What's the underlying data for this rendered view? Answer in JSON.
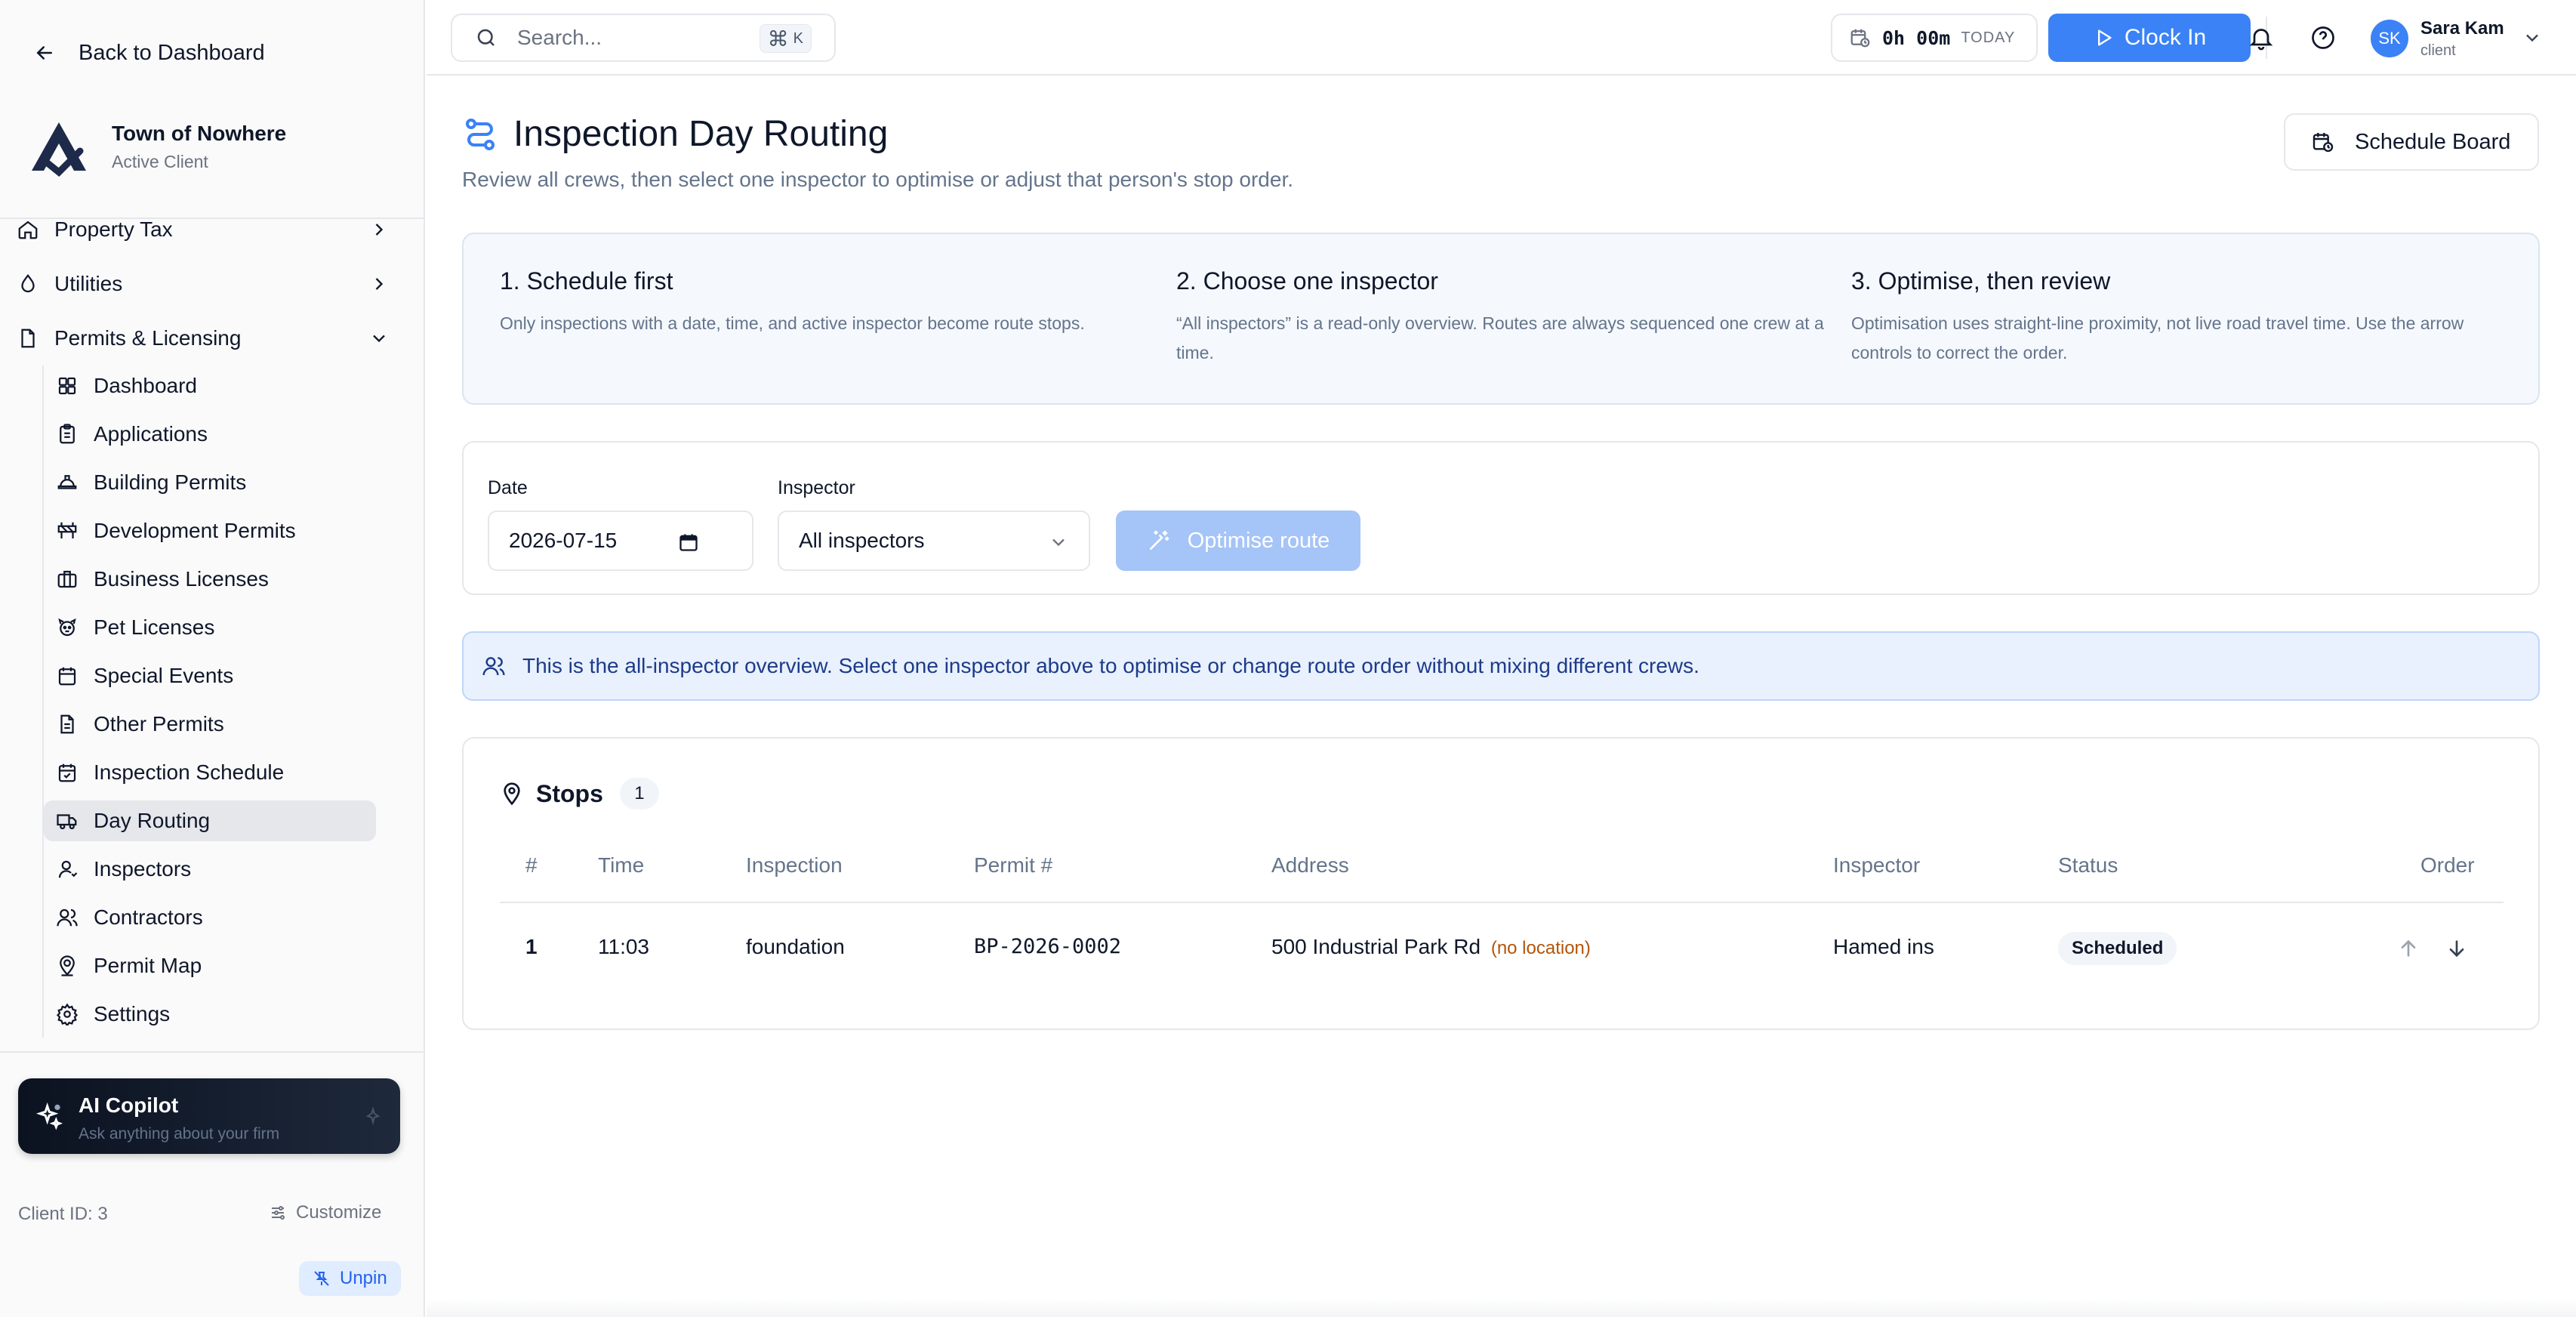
{
  "sidebar": {
    "back_label": "Back to Dashboard",
    "org_name": "Town of Nowhere",
    "org_status": "Active Client",
    "top_items": [
      {
        "label": "Property Tax",
        "icon": "home-icon"
      },
      {
        "label": "Utilities",
        "icon": "droplet-icon"
      },
      {
        "label": "Permits & Licensing",
        "icon": "file-icon"
      }
    ],
    "sub_items": [
      {
        "label": "Dashboard",
        "icon": "grid-icon"
      },
      {
        "label": "Applications",
        "icon": "clipboard-icon"
      },
      {
        "label": "Building Permits",
        "icon": "hard-hat-icon"
      },
      {
        "label": "Development Permits",
        "icon": "construction-icon"
      },
      {
        "label": "Business Licenses",
        "icon": "briefcase-icon"
      },
      {
        "label": "Pet Licenses",
        "icon": "paw-icon"
      },
      {
        "label": "Special Events",
        "icon": "calendar-icon"
      },
      {
        "label": "Other Permits",
        "icon": "document-icon"
      },
      {
        "label": "Inspection Schedule",
        "icon": "calendar-check-icon"
      },
      {
        "label": "Day Routing",
        "icon": "truck-icon"
      },
      {
        "label": "Inspectors",
        "icon": "user-icon"
      },
      {
        "label": "Contractors",
        "icon": "users-icon"
      },
      {
        "label": "Permit Map",
        "icon": "map-pin-user-icon"
      },
      {
        "label": "Settings",
        "icon": "gear-icon"
      }
    ],
    "active_item": "Day Routing",
    "copilot": {
      "title": "AI Copilot",
      "subtitle": "Ask anything about your firm"
    },
    "client_id": "Client ID: 3",
    "customize_label": "Customize",
    "unpin_label": "Unpin"
  },
  "topbar": {
    "search_placeholder": "Search...",
    "shortcut_symbol": "⌘",
    "shortcut_key": "K",
    "timer_value": "0h 00m",
    "timer_label": "TODAY",
    "clock_in_label": "Clock In",
    "user_initials": "SK",
    "user_name": "Sara Kam",
    "user_role": "client"
  },
  "page": {
    "title": "Inspection Day Routing",
    "subtitle": "Review all crews, then select one inspector to optimise or adjust that person's stop order.",
    "schedule_board_label": "Schedule Board"
  },
  "steps": [
    {
      "title": "1. Schedule first",
      "text": "Only inspections with a date, time, and active inspector become route stops."
    },
    {
      "title": "2. Choose one inspector",
      "text": "“All inspectors” is a read-only overview. Routes are always sequenced one crew at a time."
    },
    {
      "title": "3. Optimise, then review",
      "text": "Optimisation uses straight-line proximity, not live road travel time. Use the arrow controls to correct the order."
    }
  ],
  "filters": {
    "date_label": "Date",
    "date_value": "2026-07-15",
    "inspector_label": "Inspector",
    "inspector_value": "All inspectors",
    "optimise_label": "Optimise route"
  },
  "notice": "This is the all-inspector overview. Select one inspector above to optimise or change route order without mixing different crews.",
  "stops": {
    "title": "Stops",
    "count": "1",
    "columns": [
      "#",
      "Time",
      "Inspection",
      "Permit #",
      "Address",
      "Inspector",
      "Status",
      "Order"
    ],
    "rows": [
      {
        "num": "1",
        "time": "11:03",
        "inspection": "foundation",
        "permit": "BP-2026-0002",
        "address": "500 Industrial Park Rd",
        "address_note": "(no location)",
        "inspector": "Hamed ins",
        "status": "Scheduled"
      }
    ]
  },
  "colors": {
    "accent": "#3b82f6",
    "accent_disabled": "#a5c4f7",
    "notice_bg": "#e8f1fd",
    "warning_text": "#b45309"
  }
}
